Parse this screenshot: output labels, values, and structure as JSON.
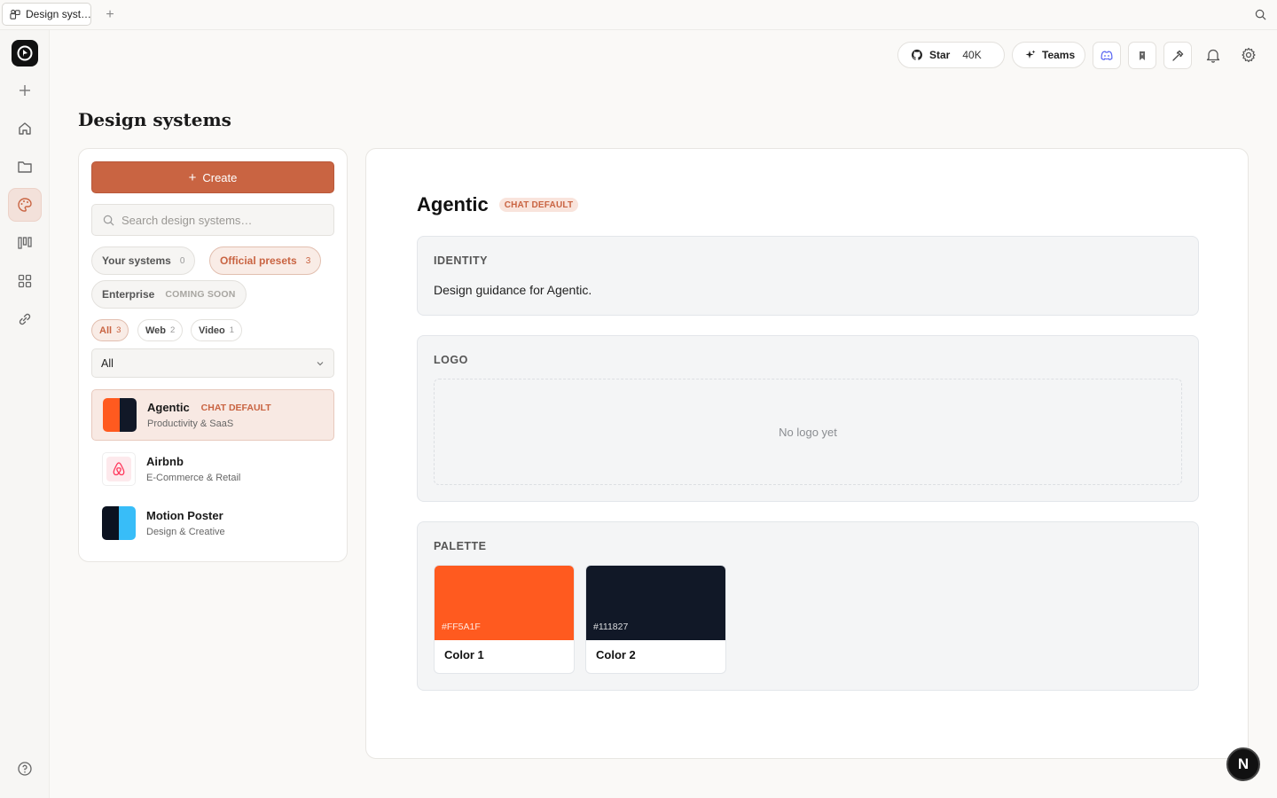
{
  "browser": {
    "tab_title": "Design syst…",
    "new_tab": "+"
  },
  "toolbar": {
    "star_label": "Star",
    "star_count": "40K",
    "teams_label": "Teams"
  },
  "page": {
    "title": "Design systems"
  },
  "sidebar_panel": {
    "create_label": "Create",
    "search_placeholder": "Search design systems…",
    "segments": [
      {
        "label": "Your systems",
        "count": "0"
      },
      {
        "label": "Official presets",
        "count": "3"
      },
      {
        "label": "Enterprise",
        "note": "COMING SOON"
      }
    ],
    "filters": [
      {
        "label": "All",
        "count": "3"
      },
      {
        "label": "Web",
        "count": "2"
      },
      {
        "label": "Video",
        "count": "1"
      }
    ],
    "category_select": "All",
    "systems": [
      {
        "name": "Agentic",
        "badge": "CHAT DEFAULT",
        "category": "Productivity & SaaS",
        "colors": [
          "#FF5A1F",
          "#111827"
        ]
      },
      {
        "name": "Airbnb",
        "category": "E-Commerce & Retail",
        "colors": [
          "#FF385C"
        ]
      },
      {
        "name": "Motion Poster",
        "category": "Design & Creative",
        "colors": [
          "#0B1220",
          "#38BDF8"
        ]
      }
    ]
  },
  "detail": {
    "title": "Agentic",
    "badge": "CHAT DEFAULT",
    "identity": {
      "label": "IDENTITY",
      "text": "Design guidance for Agentic."
    },
    "logo": {
      "label": "LOGO",
      "empty_text": "No logo yet"
    },
    "palette": {
      "label": "PALETTE",
      "colors": [
        {
          "hex": "#FF5A1F",
          "label": "#FF5A1F",
          "name": "Color 1"
        },
        {
          "hex": "#111827",
          "label": "#111827",
          "name": "Color 2"
        }
      ]
    }
  },
  "fab": {
    "label": "N"
  },
  "accent": "#C96442"
}
